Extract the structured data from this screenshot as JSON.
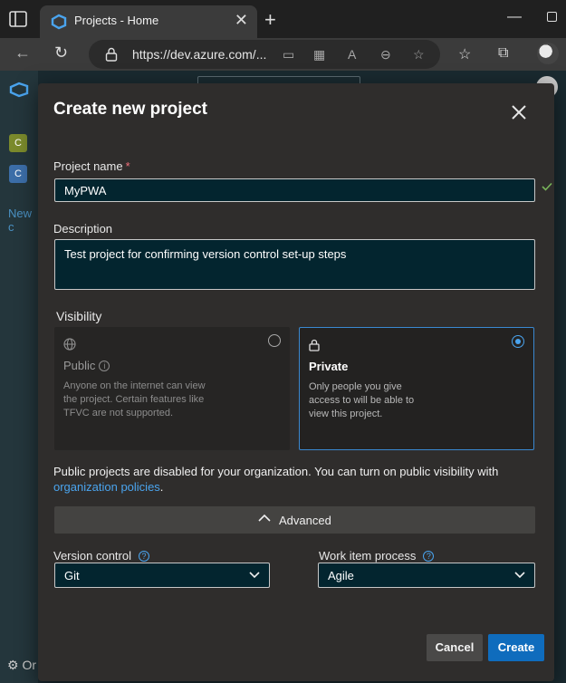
{
  "browser": {
    "tab_title": "Projects - Home",
    "url": "https://dev.azure.com/..."
  },
  "app": {
    "tile_c1": "C",
    "tile_c2": "C",
    "new_link": "New c",
    "settings_label": "Or"
  },
  "dialog": {
    "title": "Create new project",
    "project_name_label": "Project name",
    "required_mark": "*",
    "project_name_value": "MyPWA",
    "description_label": "Description",
    "description_value": "Test project for confirming version control set-up steps",
    "visibility_label": "Visibility",
    "public_title": "Public",
    "public_desc": "Anyone on the internet can view the project. Certain features like TFVC are not supported.",
    "private_title": "Private",
    "private_desc": "Only people you give access to will be able to view this project.",
    "notice_text": "Public projects are disabled for your organization. You can turn on public visibility with",
    "notice_link": "organization policies",
    "notice_end": ".",
    "advanced_label": "Advanced",
    "version_control_label": "Version control",
    "version_control_value": "Git",
    "work_item_label": "Work item process",
    "work_item_value": "Agile",
    "cancel_label": "Cancel",
    "create_label": "Create"
  },
  "colors": {
    "accent": "#0f6cbd",
    "link": "#4aa4ee",
    "input_bg": "#03252f",
    "dialog_bg": "#2f2d2c",
    "required": "#f1707b",
    "success_check": "#78b45a"
  },
  "icons": {
    "close": "close-icon",
    "public": "globe-icon",
    "private": "lock-icon",
    "info": "info-icon",
    "check": "checkmark-icon"
  }
}
